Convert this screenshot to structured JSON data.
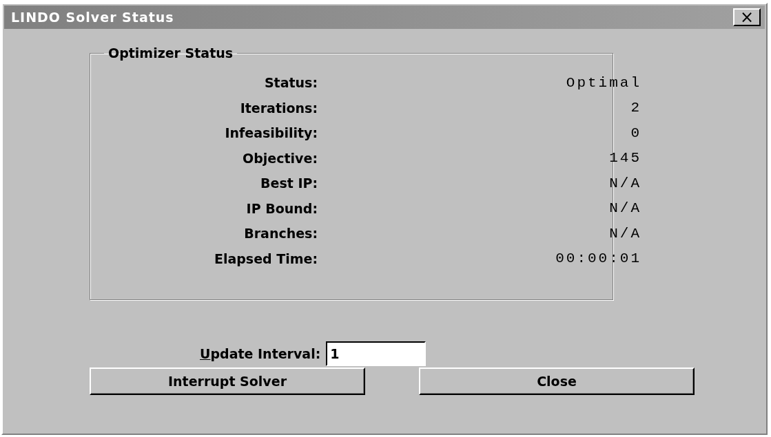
{
  "window": {
    "title": "LINDO Solver Status",
    "close_label": "×"
  },
  "group": {
    "title": "Optimizer Status",
    "rows": [
      {
        "label": "Status:",
        "value": "Optimal"
      },
      {
        "label": "Iterations:",
        "value": "2"
      },
      {
        "label": "Infeasibility:",
        "value": "0"
      },
      {
        "label": "Objective:",
        "value": "145"
      },
      {
        "label": "Best IP:",
        "value": "N/A"
      },
      {
        "label": "IP Bound:",
        "value": "N/A"
      },
      {
        "label": "Branches:",
        "value": "N/A"
      },
      {
        "label": "Elapsed Time:",
        "value": "00:00:01"
      }
    ]
  },
  "update_interval": {
    "label": "Update Interval:",
    "first_letter_underlined": true,
    "value": "1"
  },
  "buttons": [
    {
      "label": "Interrupt Solver"
    },
    {
      "label": "Close"
    }
  ]
}
